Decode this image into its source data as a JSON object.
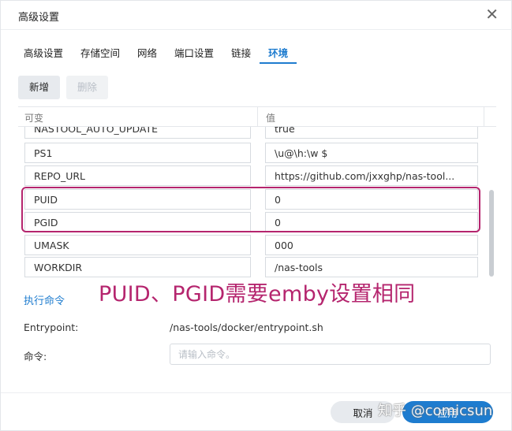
{
  "window": {
    "title": "高级设置",
    "close_icon": "close-icon"
  },
  "tabs": [
    {
      "label": "高级设置",
      "active": false
    },
    {
      "label": "存储空间",
      "active": false
    },
    {
      "label": "网络",
      "active": false
    },
    {
      "label": "端口设置",
      "active": false
    },
    {
      "label": "链接",
      "active": false
    },
    {
      "label": "环境",
      "active": true
    }
  ],
  "toolbar": {
    "add_label": "新增",
    "delete_label": "删除"
  },
  "env_table": {
    "headers": {
      "variable": "可变",
      "value": "值"
    },
    "rows": [
      {
        "key": "NASTOOL_AUTO_UPDATE",
        "value": "true"
      },
      {
        "key": "PS1",
        "value": "\\u@\\h:\\w $"
      },
      {
        "key": "REPO_URL",
        "value": "https://github.com/jxxghp/nas-tool..."
      },
      {
        "key": "PUID",
        "value": "0"
      },
      {
        "key": "PGID",
        "value": "0"
      },
      {
        "key": "UMASK",
        "value": "000"
      },
      {
        "key": "WORKDIR",
        "value": "/nas-tools"
      }
    ]
  },
  "annotation": {
    "text": "PUID、PGID需要emby设置相同",
    "color": "#b5256e"
  },
  "command_section": {
    "title": "执行命令",
    "entrypoint_label": "Entrypoint:",
    "entrypoint_value": "/nas-tools/docker/entrypoint.sh",
    "command_label": "命令:",
    "command_placeholder": "请输入命令。"
  },
  "footer": {
    "cancel_label": "取消",
    "apply_label": "应用"
  },
  "watermark": "知乎 @comicsun",
  "colors": {
    "accent": "#1e7ccf",
    "highlight": "#b5256e"
  }
}
